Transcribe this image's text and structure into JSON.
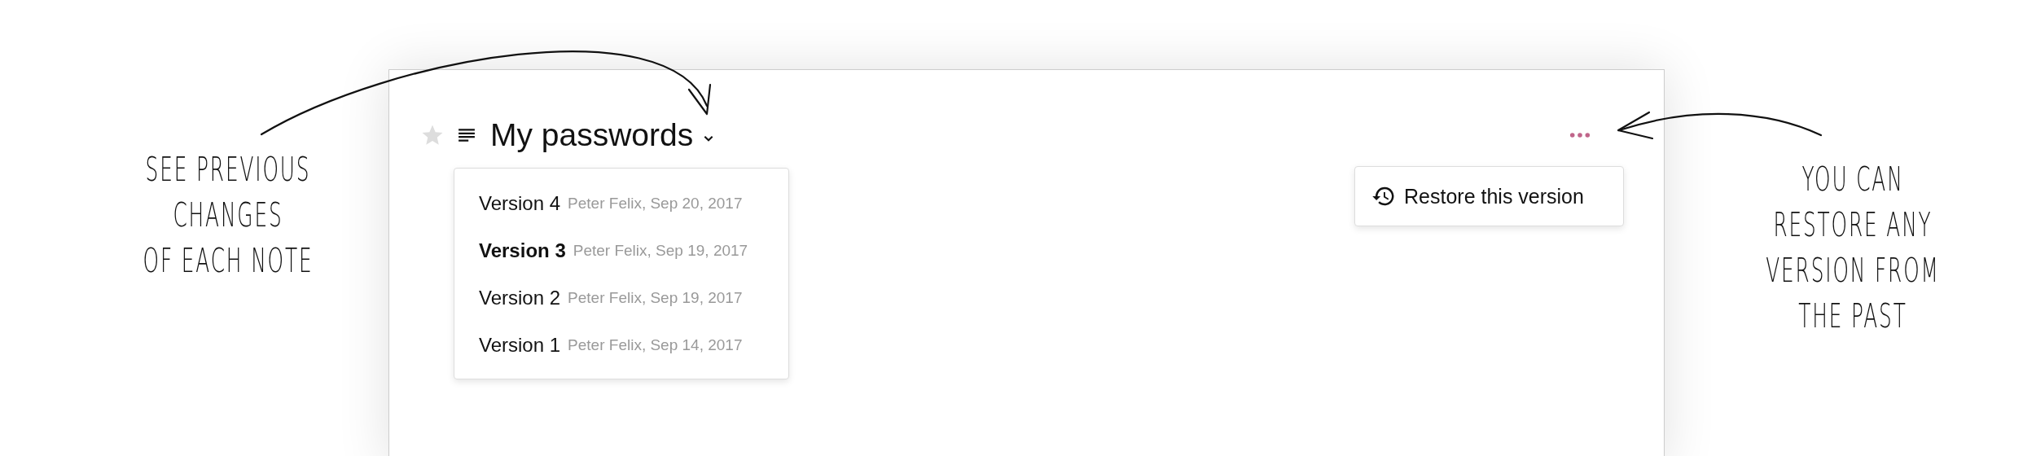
{
  "annotations": [
    {
      "kind": "left",
      "text": "SEE PREVIOUS\nCHANGES\nOF EACH NOTE"
    },
    {
      "kind": "right",
      "text": "YOU CAN\nRESTORE ANY\nVERSION FROM\nTHE PAST"
    }
  ],
  "note": {
    "starred": false,
    "title": "My passwords"
  },
  "versions": [
    {
      "name": "Version 4",
      "meta": "Peter Felix, Sep 20, 2017",
      "selected": false
    },
    {
      "name": "Version 3",
      "meta": "Peter Felix, Sep 19, 2017",
      "selected": true
    },
    {
      "name": "Version 2",
      "meta": "Peter Felix, Sep 19, 2017",
      "selected": false
    },
    {
      "name": "Version 1",
      "meta": "Peter Felix, Sep 14, 2017",
      "selected": false
    }
  ],
  "menu": {
    "items": [
      {
        "label": "Restore this version"
      }
    ]
  }
}
